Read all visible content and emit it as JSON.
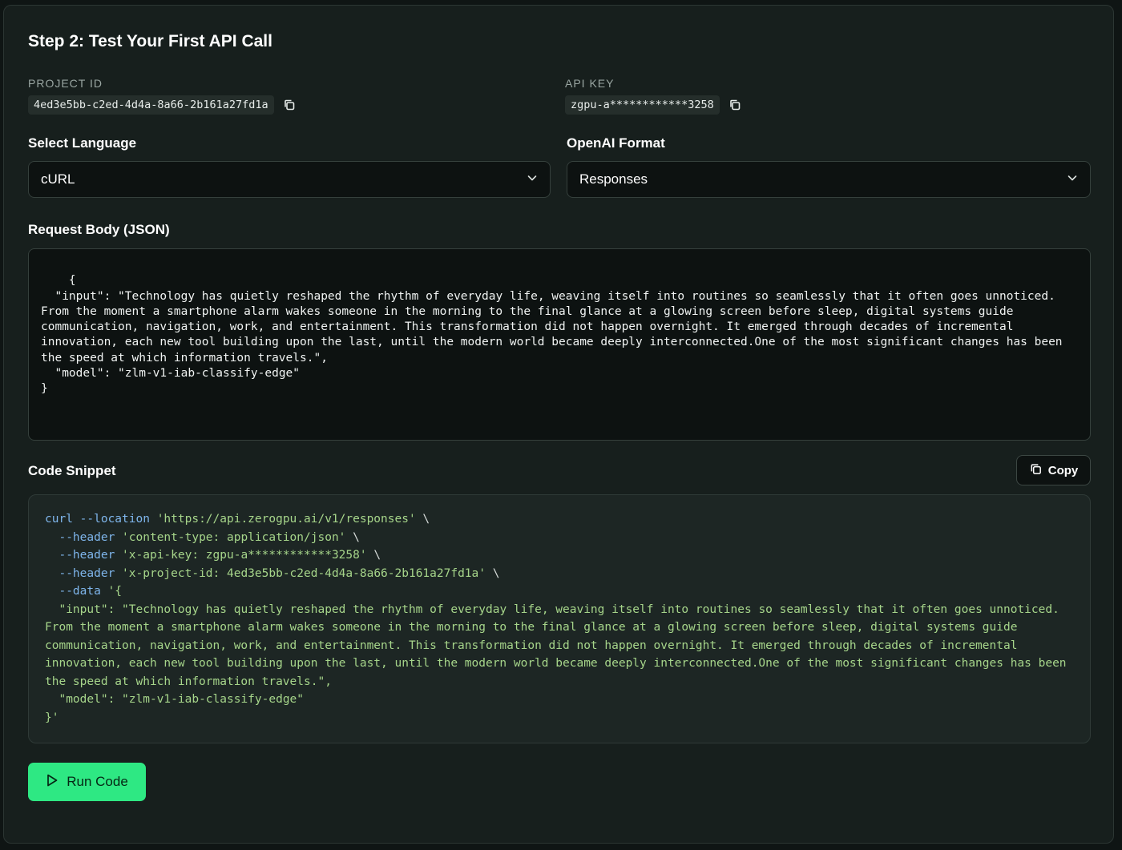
{
  "title": "Step 2: Test Your First API Call",
  "project": {
    "label": "PROJECT ID",
    "value": "4ed3e5bb-c2ed-4d4a-8a66-2b161a27fd1a"
  },
  "api_key": {
    "label": "API KEY",
    "value": "zgpu-a************3258"
  },
  "language": {
    "label": "Select Language",
    "selected": "cURL"
  },
  "format": {
    "label": "OpenAI Format",
    "selected": "Responses"
  },
  "request_body": {
    "label": "Request Body (JSON)",
    "value": "{\n  \"input\": \"Technology has quietly reshaped the rhythm of everyday life, weaving itself into routines so seamlessly that it often goes unnoticed. From the moment a smartphone alarm wakes someone in the morning to the final glance at a glowing screen before sleep, digital systems guide communication, navigation, work, and entertainment. This transformation did not happen overnight. It emerged through decades of incremental innovation, each new tool building upon the last, until the modern world became deeply interconnected.One of the most significant changes has been the speed at which information travels.\",\n  \"model\": \"zlm-v1-iab-classify-edge\"\n}"
  },
  "snippet": {
    "label": "Code Snippet",
    "copy_label": "Copy",
    "lines": {
      "l1_cmd": "curl --location ",
      "l1_str": "'https://api.zerogpu.ai/v1/responses'",
      "l1_tail": " \\",
      "l2_flag": "  --header ",
      "l2_str": "'content-type: application/json'",
      "l2_tail": " \\",
      "l3_flag": "  --header ",
      "l3_str": "'x-api-key: zgpu-a************3258'",
      "l3_tail": " \\",
      "l4_flag": "  --header ",
      "l4_str": "'x-project-id: 4ed3e5bb-c2ed-4d4a-8a66-2b161a27fd1a'",
      "l4_tail": " \\",
      "l5_flag": "  --data ",
      "l5_str": "'{",
      "body": "\n  \"input\": \"Technology has quietly reshaped the rhythm of everyday life, weaving itself into routines so seamlessly that it often goes unnoticed. From the moment a smartphone alarm wakes someone in the morning to the final glance at a glowing screen before sleep, digital systems guide communication, navigation, work, and entertainment. This transformation did not happen overnight. It emerged through decades of incremental innovation, each new tool building upon the last, until the modern world became deeply interconnected.One of the most significant changes has been the speed at which information travels.\",\n  \"model\": \"zlm-v1-iab-classify-edge\"\n}'"
    }
  },
  "run_label": "Run Code",
  "colors": {
    "accent": "#2ee883",
    "background": "#171f1d",
    "cmd_blue": "#7fb6ec",
    "string_green": "#a6d58a"
  }
}
